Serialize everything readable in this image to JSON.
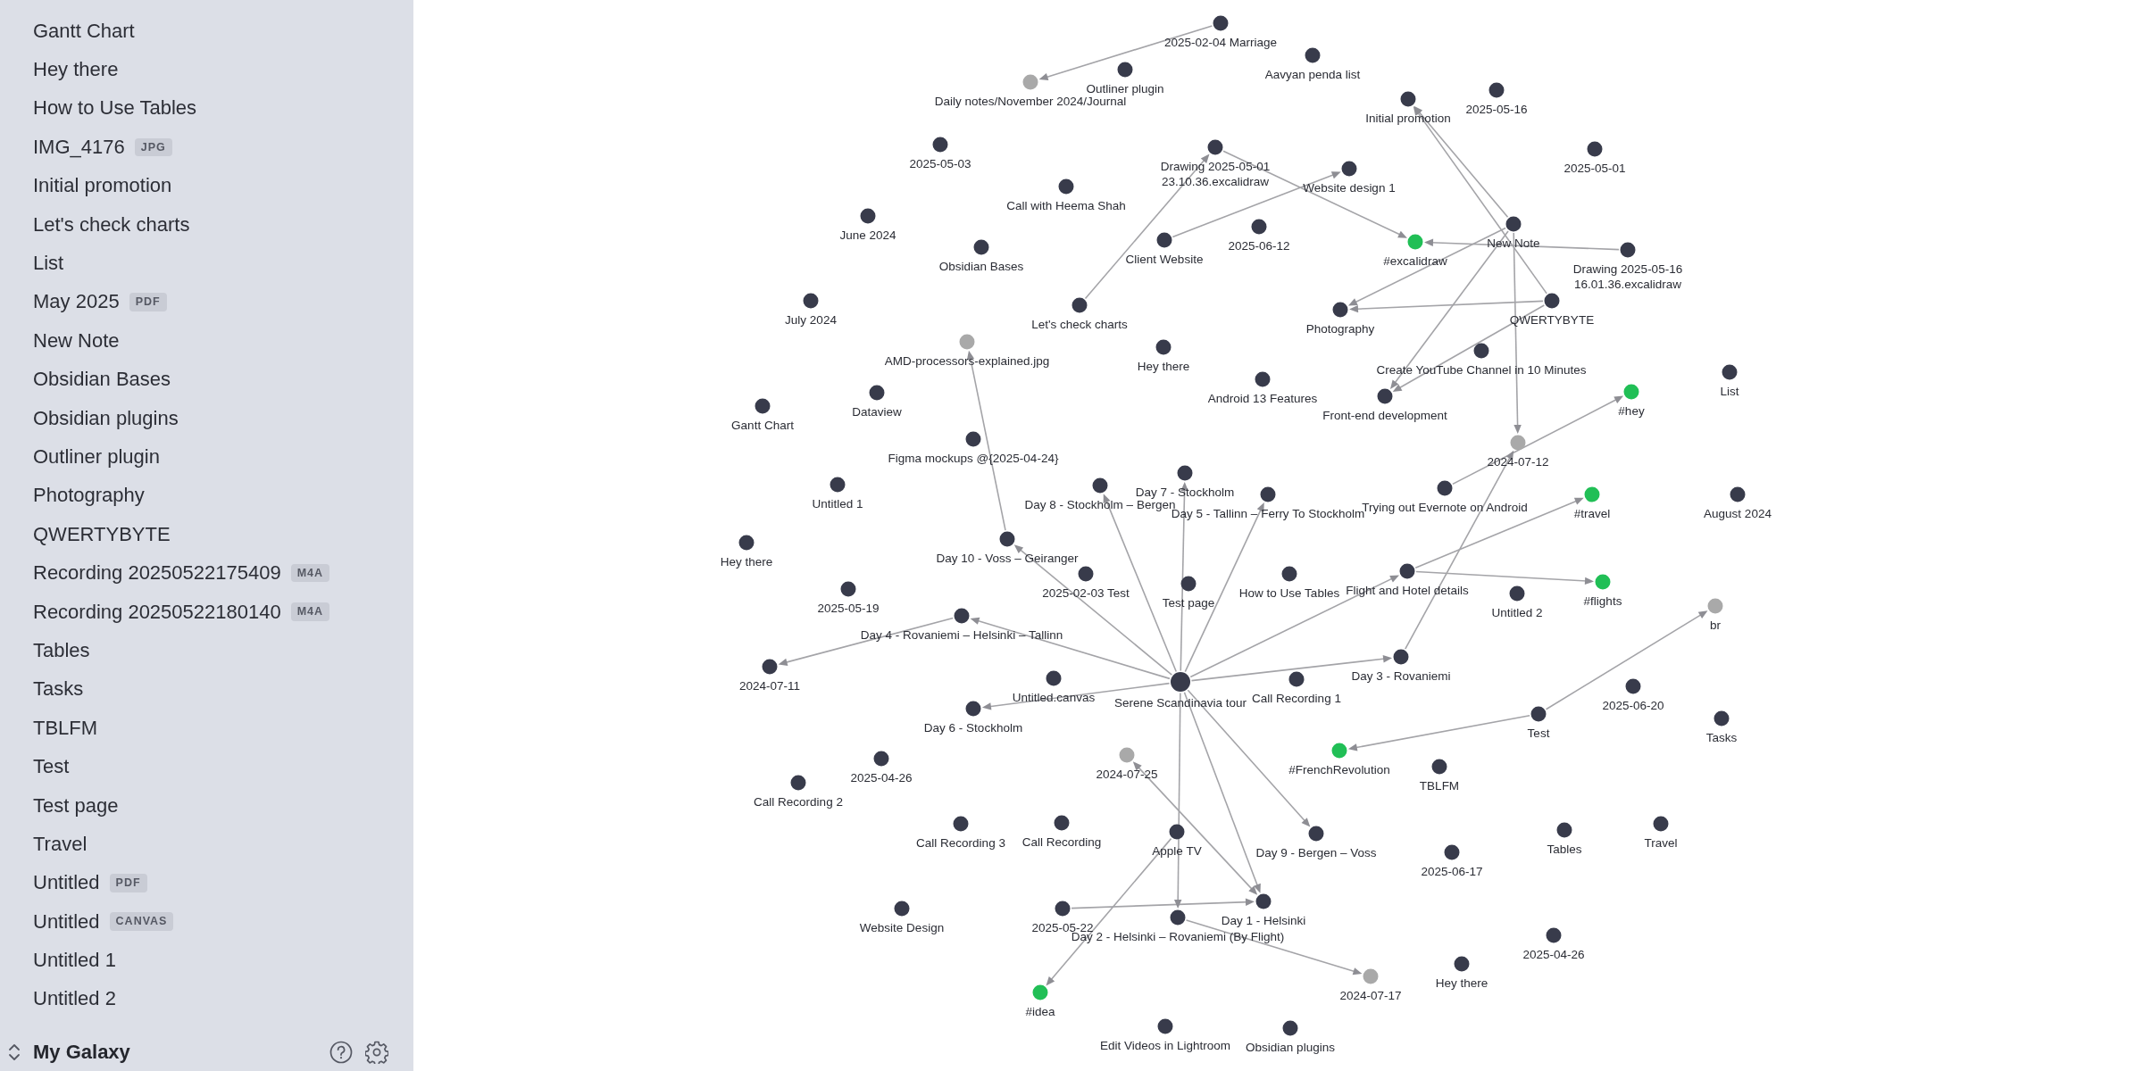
{
  "sidebar": {
    "items": [
      {
        "name": "Gantt Chart"
      },
      {
        "name": "Hey there"
      },
      {
        "name": "How to Use Tables"
      },
      {
        "name": "IMG_4176",
        "badge": "JPG"
      },
      {
        "name": "Initial promotion"
      },
      {
        "name": "Let's check charts"
      },
      {
        "name": "List"
      },
      {
        "name": "May 2025",
        "badge": "PDF"
      },
      {
        "name": "New Note"
      },
      {
        "name": "Obsidian Bases"
      },
      {
        "name": "Obsidian plugins"
      },
      {
        "name": "Outliner plugin"
      },
      {
        "name": "Photography"
      },
      {
        "name": "QWERTYBYTE"
      },
      {
        "name": "Recording 20250522175409",
        "badge": "M4A"
      },
      {
        "name": "Recording 20250522180140",
        "badge": "M4A"
      },
      {
        "name": "Tables"
      },
      {
        "name": "Tasks"
      },
      {
        "name": "TBLFM"
      },
      {
        "name": "Test"
      },
      {
        "name": "Test page"
      },
      {
        "name": "Travel"
      },
      {
        "name": "Untitled",
        "badge": "PDF"
      },
      {
        "name": "Untitled",
        "badge": "CANVAS"
      },
      {
        "name": "Untitled 1"
      },
      {
        "name": "Untitled 2"
      }
    ],
    "footer": {
      "vault_name": "My Galaxy"
    }
  },
  "graph": {
    "nodes": [
      {
        "label": "2025-02-04 Marriage",
        "color": "#383b4b"
      },
      {
        "label": "Aavyan penda list",
        "color": "#383b4b"
      },
      {
        "label": "Outliner plugin",
        "color": "#383b4b"
      },
      {
        "label": "Daily notes/November 2024/Journal",
        "color": "#a9a9a9"
      },
      {
        "label": "Initial promotion",
        "color": "#383b4b"
      },
      {
        "label": "2025-05-16",
        "color": "#383b4b"
      },
      {
        "label": "2025-05-03",
        "color": "#383b4b"
      },
      {
        "label": "Drawing 2025-05-01 23.10.36.excalidraw",
        "color": "#383b4b"
      },
      {
        "label": "2025-05-01",
        "color": "#383b4b"
      },
      {
        "label": "Website design 1",
        "color": "#383b4b"
      },
      {
        "label": "Call with Heema Shah",
        "color": "#383b4b"
      },
      {
        "label": "June 2024",
        "color": "#383b4b"
      },
      {
        "label": "2025-06-12",
        "color": "#383b4b"
      },
      {
        "label": "New Note",
        "color": "#383b4b"
      },
      {
        "label": "Obsidian Bases",
        "color": "#383b4b"
      },
      {
        "label": "Client Website",
        "color": "#383b4b"
      },
      {
        "label": "#excalidraw",
        "color": "#21bf56"
      },
      {
        "label": "Drawing 2025-05-16 16.01.36.excalidraw",
        "color": "#383b4b"
      },
      {
        "label": "July 2024",
        "color": "#383b4b"
      },
      {
        "label": "Let's check charts",
        "color": "#383b4b"
      },
      {
        "label": "Photography",
        "color": "#383b4b"
      },
      {
        "label": "QWERTYBYTE",
        "color": "#383b4b"
      },
      {
        "label": "AMD-processors-explained.jpg",
        "color": "#a9a9a9"
      },
      {
        "label": "Hey there",
        "color": "#383b4b"
      },
      {
        "label": "Create YouTube Channel in 10 Minutes",
        "color": "#383b4b"
      },
      {
        "label": "Android 13 Features",
        "color": "#383b4b"
      },
      {
        "label": "List",
        "color": "#383b4b"
      },
      {
        "label": "Dataview",
        "color": "#383b4b"
      },
      {
        "label": "Front-end development",
        "color": "#383b4b"
      },
      {
        "label": "#hey",
        "color": "#21bf56"
      },
      {
        "label": "Gantt Chart",
        "color": "#383b4b"
      },
      {
        "label": "Figma mockups @{2025-04-24}",
        "color": "#383b4b"
      },
      {
        "label": "2024-07-12",
        "color": "#a9a9a9"
      },
      {
        "label": "Day 7 - Stockholm",
        "color": "#383b4b"
      },
      {
        "label": "Untitled 1",
        "color": "#383b4b"
      },
      {
        "label": "Day 8 - Stockholm – Bergen",
        "color": "#383b4b"
      },
      {
        "label": "Day 5 - Tallinn – Ferry To Stockholm",
        "color": "#383b4b"
      },
      {
        "label": "Trying out Evernote on Android",
        "color": "#383b4b"
      },
      {
        "label": "#travel",
        "color": "#21bf56"
      },
      {
        "label": "August 2024",
        "color": "#383b4b"
      },
      {
        "label": "Hey there",
        "color": "#383b4b"
      },
      {
        "label": "Day 10 - Voss – Geiranger",
        "color": "#383b4b"
      },
      {
        "label": "2025-02-03 Test",
        "color": "#383b4b"
      },
      {
        "label": "How to Use Tables",
        "color": "#383b4b"
      },
      {
        "label": "Flight and Hotel details",
        "color": "#383b4b"
      },
      {
        "label": "2025-05-19",
        "color": "#383b4b"
      },
      {
        "label": "Test page",
        "color": "#383b4b"
      },
      {
        "label": "#flights",
        "color": "#21bf56"
      },
      {
        "label": "Untitled 2",
        "color": "#383b4b"
      },
      {
        "label": "br",
        "color": "#a9a9a9"
      },
      {
        "label": "Day 4 - Rovaniemi – Helsinki – Tallinn",
        "color": "#383b4b"
      },
      {
        "label": "Day 3 - Rovaniemi",
        "color": "#383b4b"
      },
      {
        "label": "2024-07-11",
        "color": "#383b4b"
      },
      {
        "label": "Untitled.canvas",
        "color": "#383b4b"
      },
      {
        "label": "Serene Scandinavia tour",
        "color": "#383b4b"
      },
      {
        "label": "Call Recording 1",
        "color": "#383b4b"
      },
      {
        "label": "2025-06-20",
        "color": "#383b4b"
      },
      {
        "label": "Day 6 - Stockholm",
        "color": "#383b4b"
      },
      {
        "label": "Test",
        "color": "#383b4b"
      },
      {
        "label": "Tasks",
        "color": "#383b4b"
      },
      {
        "label": "2025-04-26",
        "color": "#383b4b"
      },
      {
        "label": "2024-07-25",
        "color": "#a9a9a9"
      },
      {
        "label": "#FrenchRevolution",
        "color": "#21bf56"
      },
      {
        "label": "TBLFM",
        "color": "#383b4b"
      },
      {
        "label": "Call Recording 2",
        "color": "#383b4b"
      },
      {
        "label": "Call Recording 3",
        "color": "#383b4b"
      },
      {
        "label": "Call Recording",
        "color": "#383b4b"
      },
      {
        "label": "Apple TV",
        "color": "#383b4b"
      },
      {
        "label": "Day 9 - Bergen – Voss",
        "color": "#383b4b"
      },
      {
        "label": "Tables",
        "color": "#383b4b"
      },
      {
        "label": "Travel",
        "color": "#383b4b"
      },
      {
        "label": "2025-06-17",
        "color": "#383b4b"
      },
      {
        "label": "Website Design",
        "color": "#383b4b"
      },
      {
        "label": "2025-05-22",
        "color": "#383b4b"
      },
      {
        "label": "Day 1 - Helsinki",
        "color": "#383b4b"
      },
      {
        "label": "Day 2 - Helsinki – Rovaniemi (By Flight)",
        "color": "#383b4b"
      },
      {
        "label": "2025-04-26",
        "color": "#383b4b"
      },
      {
        "label": "Hey there",
        "color": "#383b4b"
      },
      {
        "label": "2024-07-17",
        "color": "#a9a9a9"
      },
      {
        "label": "#idea",
        "color": "#21bf56"
      },
      {
        "label": "Edit Videos in Lightroom",
        "color": "#383b4b"
      },
      {
        "label": "Obsidian plugins",
        "color": "#383b4b"
      }
    ]
  }
}
